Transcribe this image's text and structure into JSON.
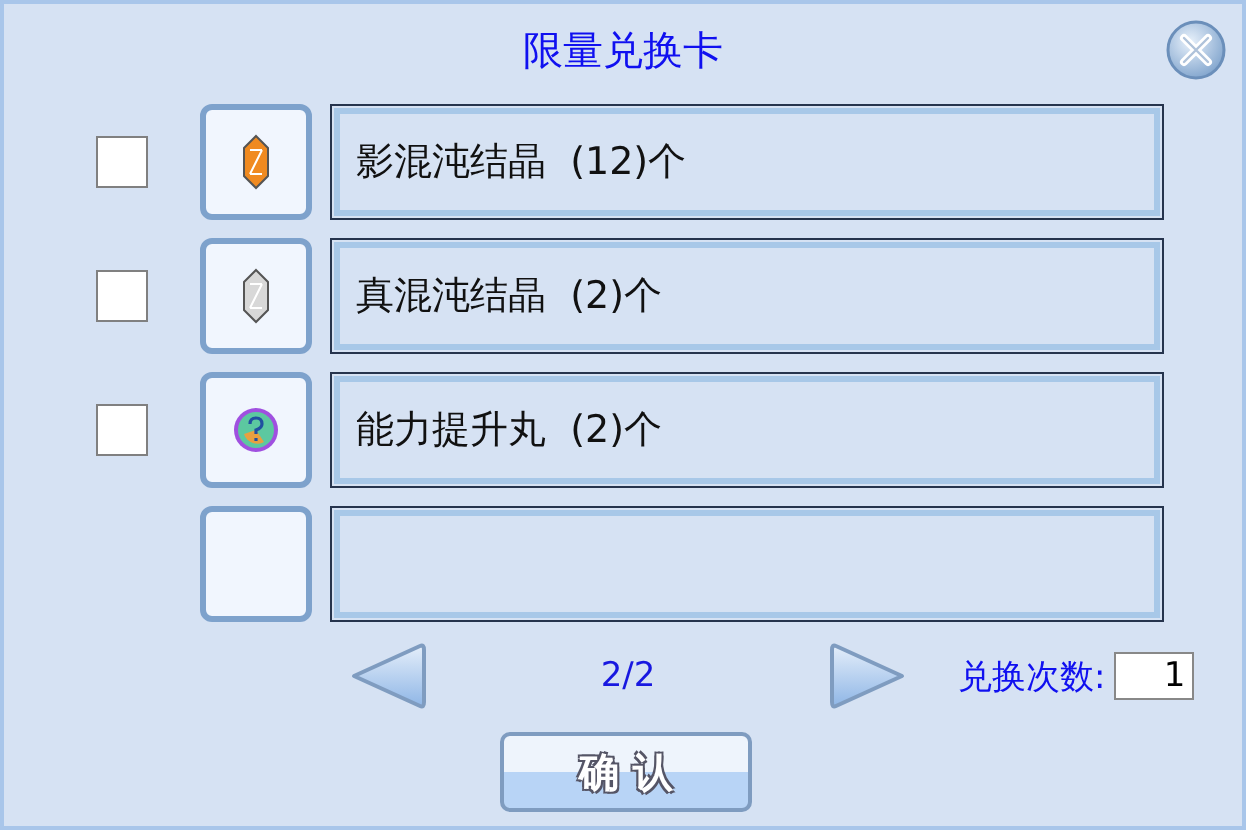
{
  "window": {
    "title": "限量兑换卡"
  },
  "slots": [
    {
      "kind": "crystal",
      "color": "#f08a20",
      "label": "影混沌结晶  (12)个",
      "checked": false
    },
    {
      "kind": "crystal",
      "color": "#d8d8d8",
      "label": "真混沌结晶  (2)个",
      "checked": false
    },
    {
      "kind": "orb",
      "label": "能力提升丸  (2)个",
      "checked": false
    },
    {
      "kind": "empty"
    }
  ],
  "pager": {
    "page": "2/2"
  },
  "count": {
    "label": "兑换次数:",
    "value": "1"
  },
  "confirm_button": "确 认"
}
